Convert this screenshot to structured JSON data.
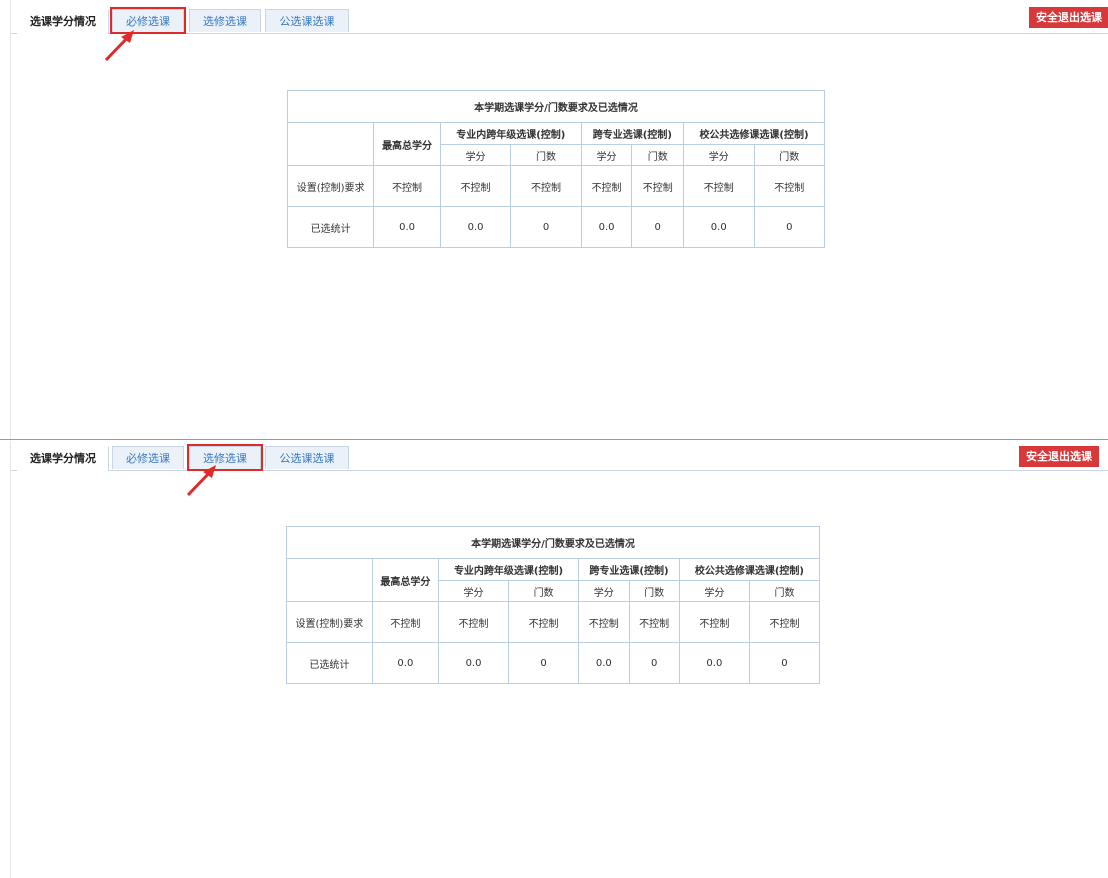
{
  "tabs": [
    "选课学分情况",
    "必修选课",
    "选修选课",
    "公选课选课"
  ],
  "exit_button": "安全退出选课",
  "table": {
    "caption": "本学期选课学分/门数要求及已选情况",
    "col_max_credit": "最高总学分",
    "groups": [
      "专业内跨年级选课(控制)",
      "跨专业选课(控制)",
      "校公共选修课选课(控制)"
    ],
    "sub_credit": "学分",
    "sub_count": "门数",
    "rows": [
      {
        "label": "设置(控制)要求",
        "cells": [
          "不控制",
          "不控制",
          "不控制",
          "不控制",
          "不控制",
          "不控制",
          "不控制"
        ]
      },
      {
        "label": "已选统计",
        "cells": [
          "0.0",
          "0.0",
          "0",
          "0.0",
          "0",
          "0.0",
          "0"
        ]
      }
    ]
  },
  "highlight_colors": {
    "annotation": "#e02a2a",
    "exit_button": "#d9383a"
  }
}
